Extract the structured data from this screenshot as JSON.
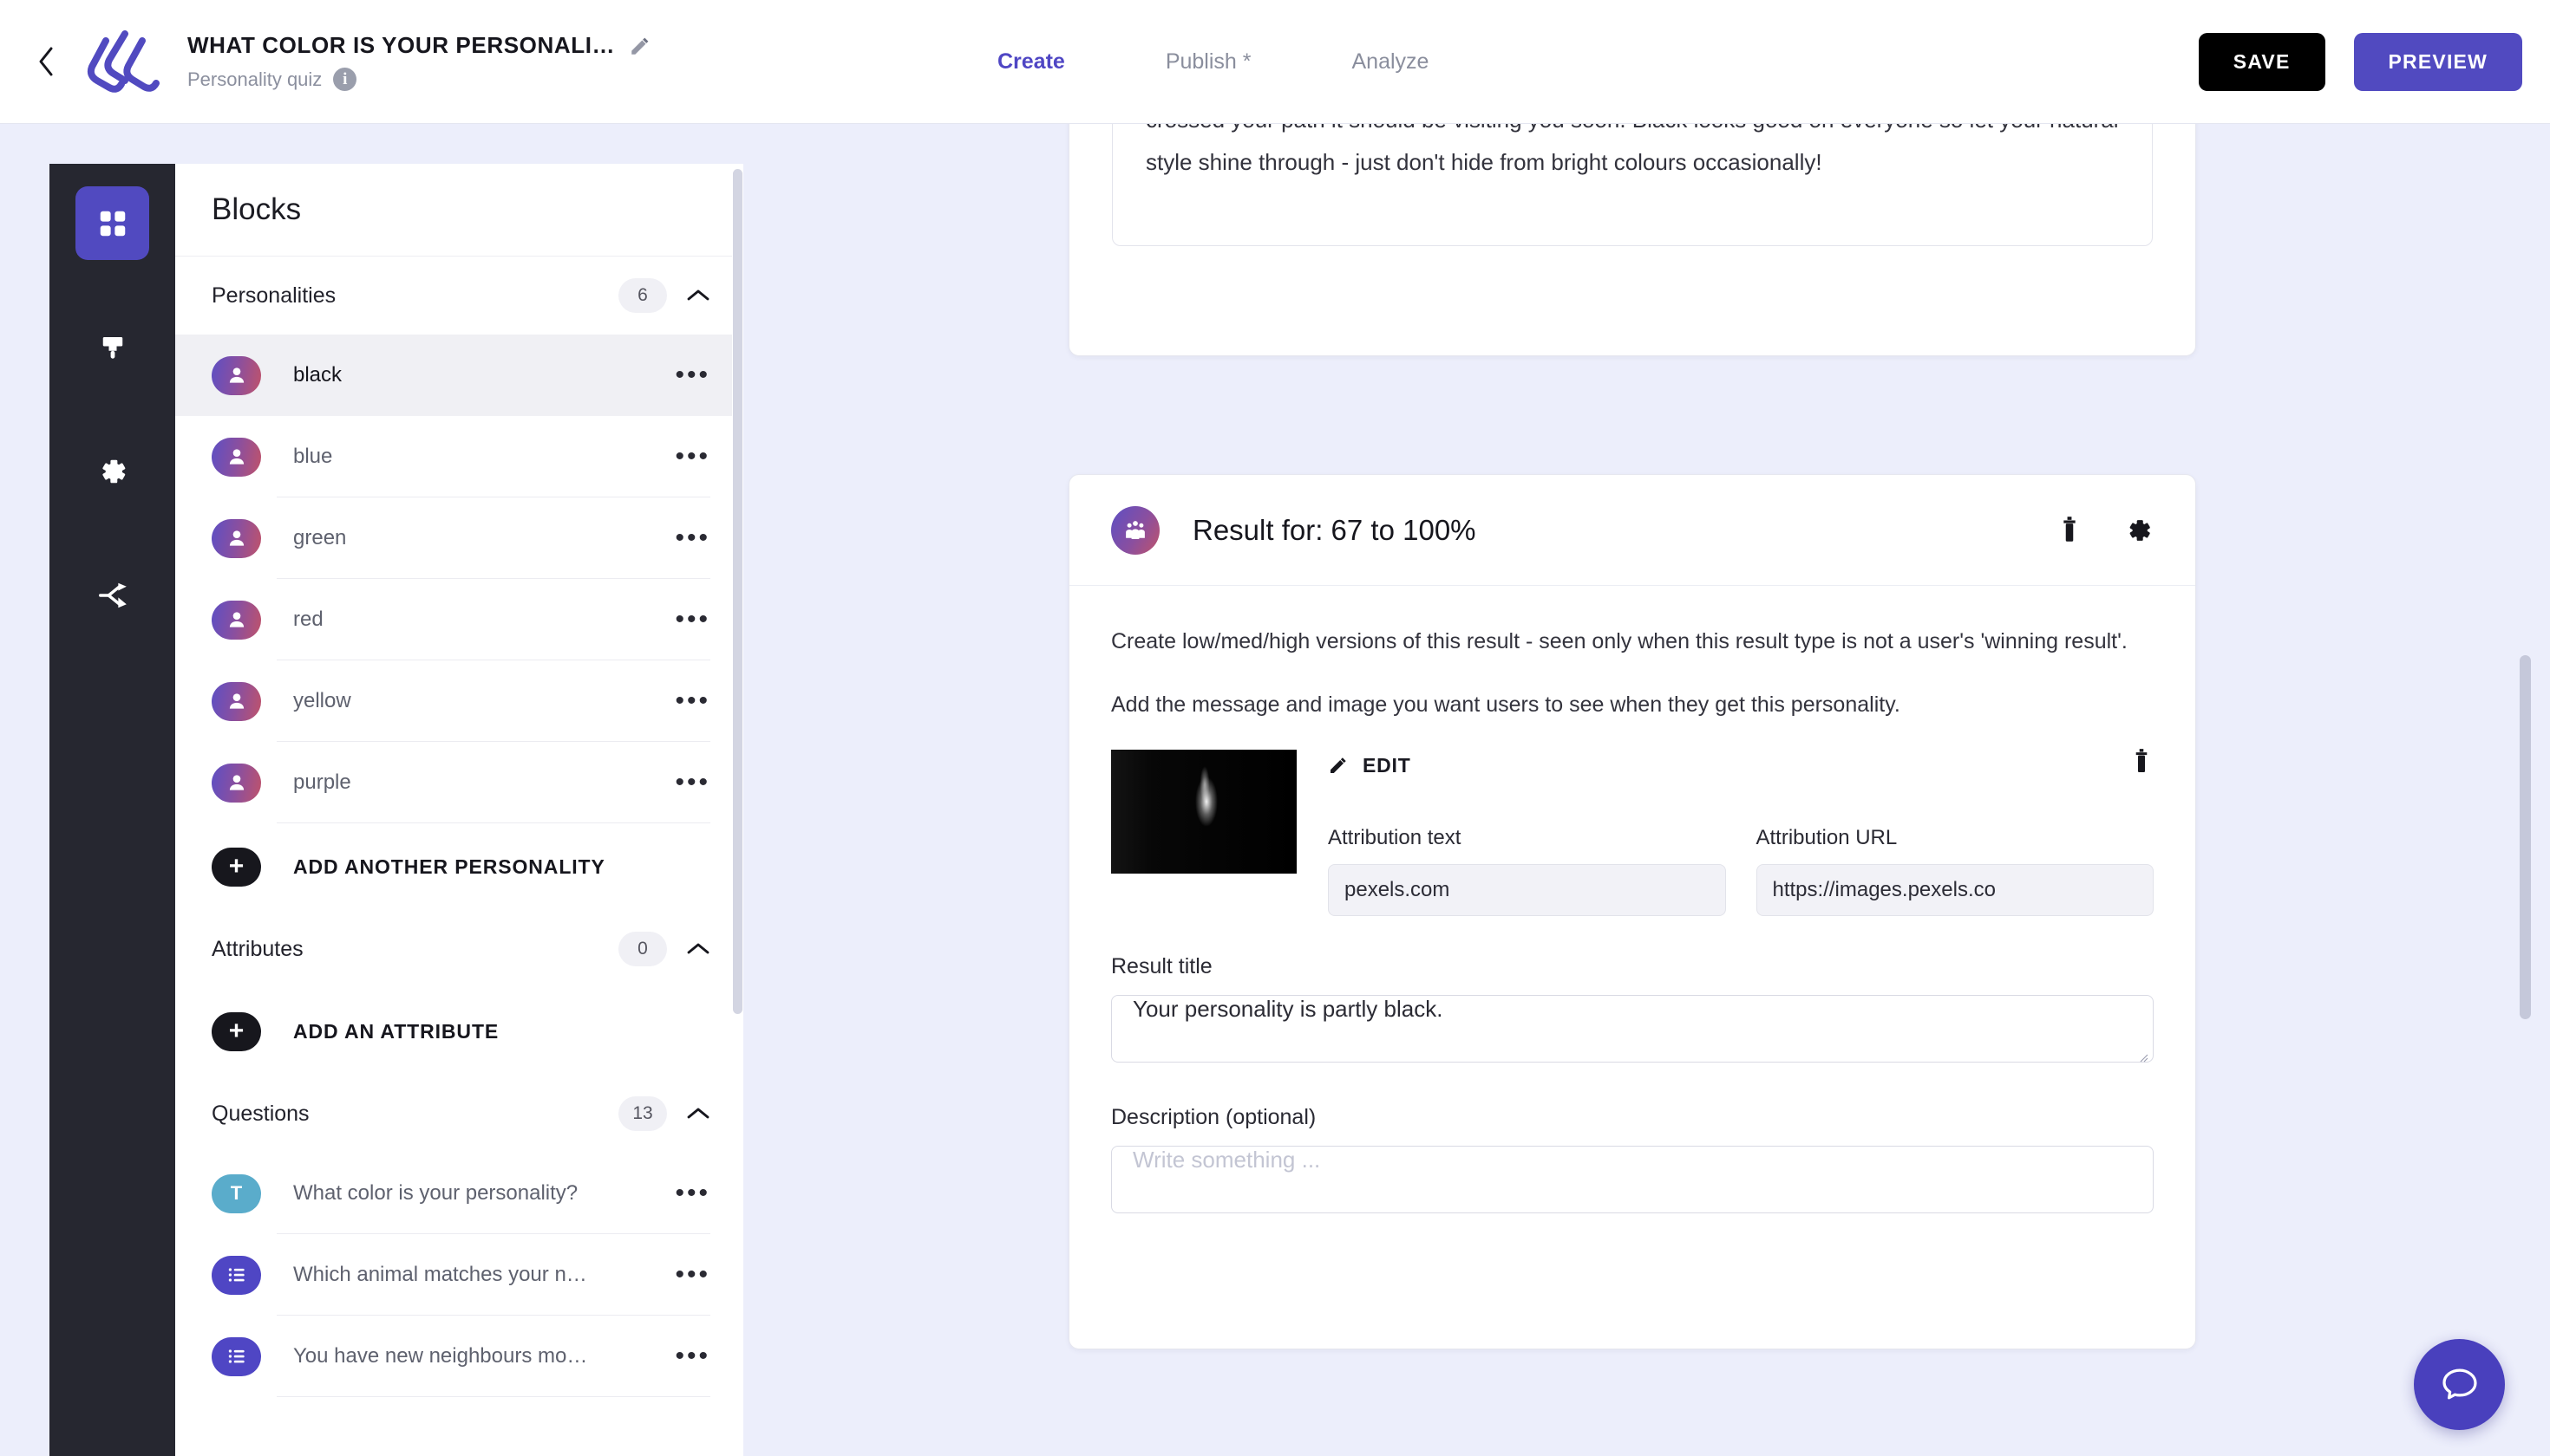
{
  "topbar": {
    "back_icon": "chevron-left-icon",
    "logo_icon": "interact-logo",
    "quiz_title": "WHAT COLOR IS YOUR PERSONALI…",
    "edit_title_icon": "pencil-icon",
    "quiz_subtitle": "Personality quiz",
    "info_icon": "info-icon",
    "tabs": [
      {
        "label": "Create",
        "active": true
      },
      {
        "label": "Publish *",
        "active": false
      },
      {
        "label": "Analyze",
        "active": false
      }
    ],
    "save_label": "SAVE",
    "preview_label": "PREVIEW",
    "accent_color": "#514ac0",
    "save_color": "#000000"
  },
  "rail": {
    "items": [
      {
        "icon": "grid-blocks-icon",
        "active": true
      },
      {
        "icon": "paintbrush-icon",
        "active": false
      },
      {
        "icon": "gear-icon",
        "active": false
      },
      {
        "icon": "share-branch-icon",
        "active": false
      }
    ]
  },
  "panel": {
    "heading": "Blocks",
    "sections": [
      {
        "title": "Personalities",
        "count": "6",
        "collapse_icon": "chevron-up-icon",
        "items": [
          {
            "label": "black",
            "badge": "person-icon",
            "selected": true
          },
          {
            "label": "blue",
            "badge": "person-icon",
            "selected": false
          },
          {
            "label": "green",
            "badge": "person-icon",
            "selected": false
          },
          {
            "label": "red",
            "badge": "person-icon",
            "selected": false
          },
          {
            "label": "yellow",
            "badge": "person-icon",
            "selected": false
          },
          {
            "label": "purple",
            "badge": "person-icon",
            "selected": false
          }
        ],
        "add_label": "ADD ANOTHER PERSONALITY"
      },
      {
        "title": "Attributes",
        "count": "0",
        "collapse_icon": "chevron-up-icon",
        "items": [],
        "add_label": "ADD AN ATTRIBUTE"
      },
      {
        "title": "Questions",
        "count": "13",
        "collapse_icon": "chevron-up-icon",
        "items": [
          {
            "label": "What color is your personality?",
            "badge": "text-question-icon"
          },
          {
            "label": "Which animal matches your n…",
            "badge": "choice-question-icon"
          },
          {
            "label": "You have new neighbours mo…",
            "badge": "choice-question-icon"
          }
        ]
      }
    ],
    "row_menu_icon": "ellipsis-icon",
    "add_icon": "plus-icon"
  },
  "main": {
    "top_card": {
      "paragraph": "of character and a never-say-die approach to difficult challenges so if success has not yet crossed your path it should be visiting you soon. Black looks good on everyone so let your natural style shine through - just don't hide from bright colours occasionally!"
    },
    "result_card": {
      "badge_icon": "people-group-icon",
      "title": "Result for: 67 to 100%",
      "delete_icon": "trash-icon",
      "settings_icon": "gear-icon",
      "help_text_1": "Create low/med/high versions of this result - seen only when this result type is not a user's 'winning result'.",
      "help_text_2": "Add the message and image you want users to see when they get this personality.",
      "image_alt": "result-thumbnail",
      "edit_icon": "pencil-icon",
      "edit_label": "EDIT",
      "image_delete_icon": "trash-icon",
      "attribution_text_label": "Attribution text",
      "attribution_text_value": "pexels.com",
      "attribution_url_label": "Attribution URL",
      "attribution_url_value": "https://images.pexels.co",
      "result_title_label": "Result title",
      "result_title_value": "Your personality is partly black.",
      "description_label": "Description (optional)",
      "description_value": "",
      "description_placeholder": "Write something ..."
    },
    "chat_icon": "chat-bubble-icon"
  }
}
